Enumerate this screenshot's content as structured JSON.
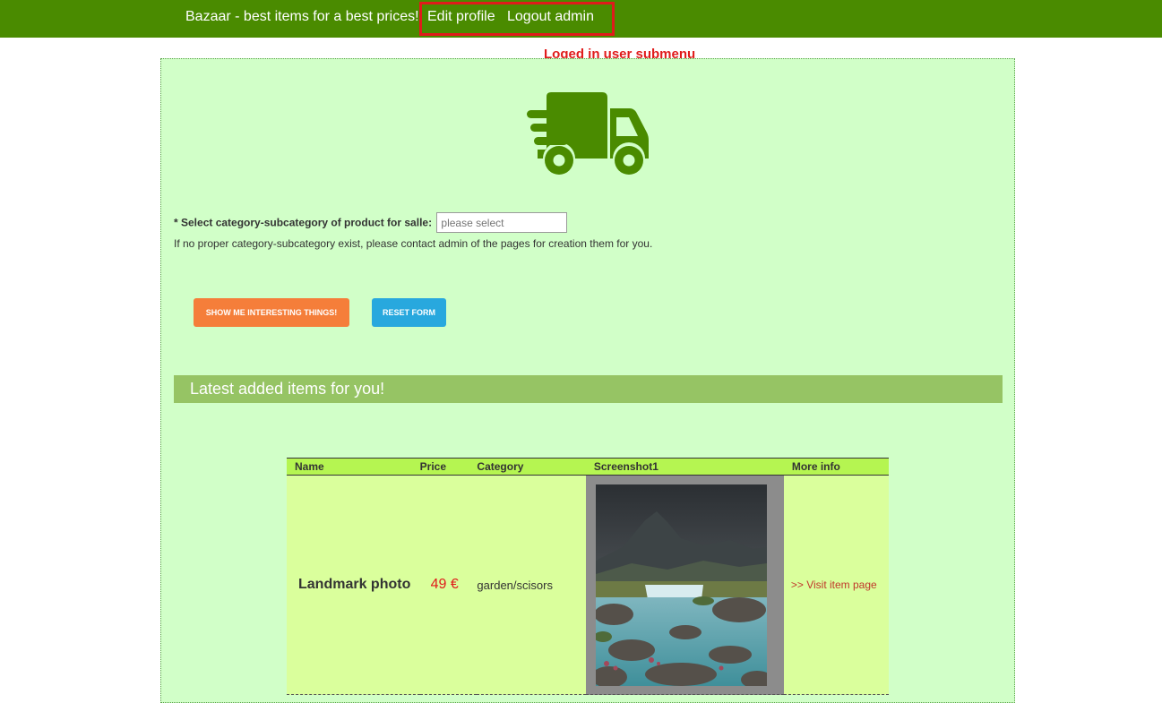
{
  "nav": {
    "brand": "Bazaar - best items for a best prices!",
    "edit_profile": "Edit profile",
    "logout": "Logout admin"
  },
  "annotation": "Loged in user submenu",
  "form": {
    "select_label": "* Select category-subcategory of product for salle:",
    "select_placeholder": "please select",
    "help_text": "If no proper category-subcategory exist, please contact admin of the pages for creation them for you.",
    "show_button": "SHOW ME INTERESTING THINGS!",
    "reset_button": "RESET FORM"
  },
  "latest": {
    "header": "Latest added items for you!",
    "columns": [
      "Name",
      "Price",
      "Category",
      "Screenshot1",
      "More info"
    ],
    "rows": [
      {
        "name": "Landmark photo",
        "price": "49 €",
        "category": "garden/scisors",
        "more_link": ">> Visit item page"
      }
    ]
  },
  "icons": {
    "truck": "delivery-truck-icon"
  },
  "colors": {
    "topbar": "#4a8b00",
    "panel": "#d1ffc8",
    "accent_orange": "#f57e3a",
    "accent_blue": "#28a8de",
    "section_header": "#96c464",
    "table_header": "#b5f551",
    "table_row": "#daff9c",
    "annotation_red": "#e01b1b"
  }
}
